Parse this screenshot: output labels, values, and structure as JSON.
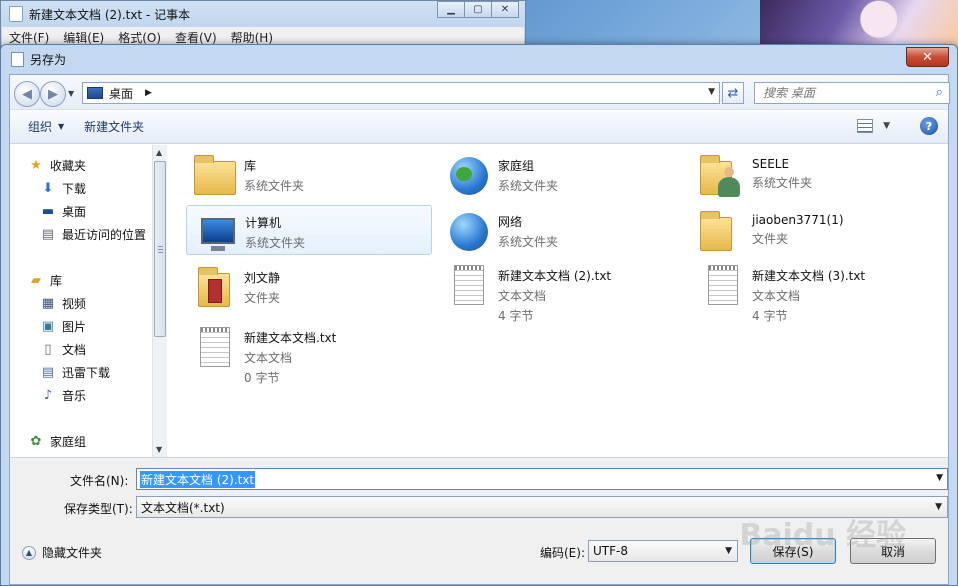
{
  "notepad": {
    "title": "新建文本文档 (2).txt - 记事本",
    "menu": [
      "文件(F)",
      "编辑(E)",
      "格式(O)",
      "查看(V)",
      "帮助(H)"
    ]
  },
  "dialog": {
    "title": "另存为",
    "address": "桌面",
    "search_placeholder": "搜索 桌面",
    "toolbar": {
      "organize": "组织",
      "new_folder": "新建文件夹"
    },
    "nav": {
      "favorites": {
        "label": "收藏夹",
        "items": [
          "下载",
          "桌面",
          "最近访问的位置"
        ]
      },
      "libraries": {
        "label": "库",
        "items": [
          "视频",
          "图片",
          "文档",
          "迅雷下载",
          "音乐"
        ]
      },
      "homegroup": "家庭组"
    },
    "files": [
      {
        "name": "库",
        "sub": "系统文件夹",
        "sub2": "",
        "icon": "library-folder-icon"
      },
      {
        "name": "家庭组",
        "sub": "系统文件夹",
        "sub2": "",
        "icon": "homegroup-icon"
      },
      {
        "name": "SEELE",
        "sub": "系统文件夹",
        "sub2": "",
        "icon": "user-folder-icon"
      },
      {
        "name": "计算机",
        "sub": "系统文件夹",
        "sub2": "",
        "icon": "computer-icon"
      },
      {
        "name": "网络",
        "sub": "系统文件夹",
        "sub2": "",
        "icon": "network-icon"
      },
      {
        "name": "jiaoben3771(1)",
        "sub": "文件夹",
        "sub2": "",
        "icon": "folder-icon"
      },
      {
        "name": "刘文静",
        "sub": "文件夹",
        "sub2": "",
        "icon": "folder-icon"
      },
      {
        "name": "新建文本文档 (2).txt",
        "sub": "文本文档",
        "sub2": "4 字节",
        "icon": "text-file-icon"
      },
      {
        "name": "新建文本文档 (3).txt",
        "sub": "文本文档",
        "sub2": "4 字节",
        "icon": "text-file-icon"
      },
      {
        "name": "新建文本文档.txt",
        "sub": "文本文档",
        "sub2": "0 字节",
        "icon": "text-file-icon"
      }
    ],
    "filename_label": "文件名(N):",
    "filename_value": "新建文本文档 (2).txt",
    "filetype_label": "保存类型(T):",
    "filetype_value": "文本文档(*.txt)",
    "encoding_label": "编码(E):",
    "encoding_value": "UTF-8",
    "hide_folders": "隐藏文件夹",
    "save_button": "保存(S)",
    "cancel_button": "取消",
    "watermark": "Baidu 经验"
  }
}
